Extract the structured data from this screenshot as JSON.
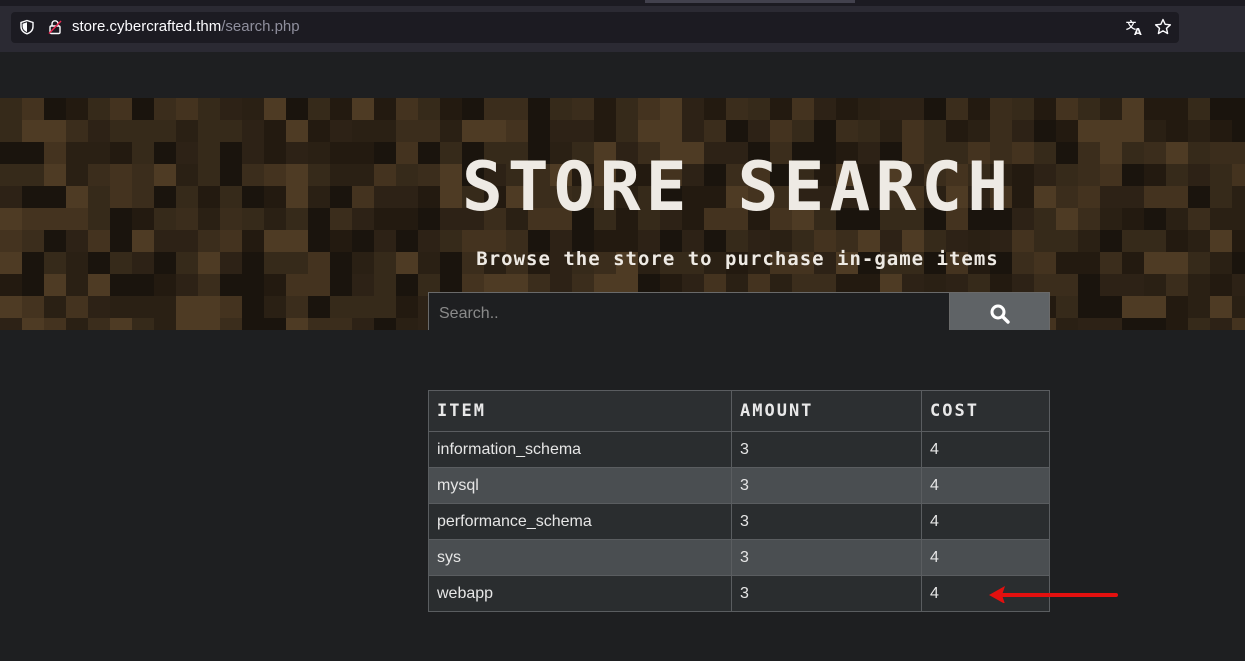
{
  "browser": {
    "url_host": "store.cybercrafted.thm",
    "url_path": "/search.php",
    "icons": [
      "shield-icon",
      "lock-icon",
      "translate-icon",
      "bookmark-star-icon"
    ]
  },
  "banner": {
    "title": "STORE SEARCH",
    "subtitle": "Browse the store to purchase in-game items"
  },
  "search": {
    "placeholder": "Search..",
    "value": "",
    "button_icon": "search-icon"
  },
  "table": {
    "headers": [
      "ITEM",
      "AMOUNT",
      "COST"
    ],
    "rows": [
      [
        "information_schema",
        "3",
        "4"
      ],
      [
        "mysql",
        "3",
        "4"
      ],
      [
        "performance_schema",
        "3",
        "4"
      ],
      [
        "sys",
        "3",
        "4"
      ],
      [
        "webapp",
        "3",
        "4"
      ]
    ]
  },
  "annotation": {
    "arrow_color": "#e3100f",
    "points_to": "webapp"
  },
  "colors": {
    "page_bg": "#1e1f21",
    "browser_chrome": "#2b2a33",
    "banner_dirt_dark": "#2a2014",
    "row_even": "#4a4e51",
    "row_odd": "#2a2d2f"
  }
}
